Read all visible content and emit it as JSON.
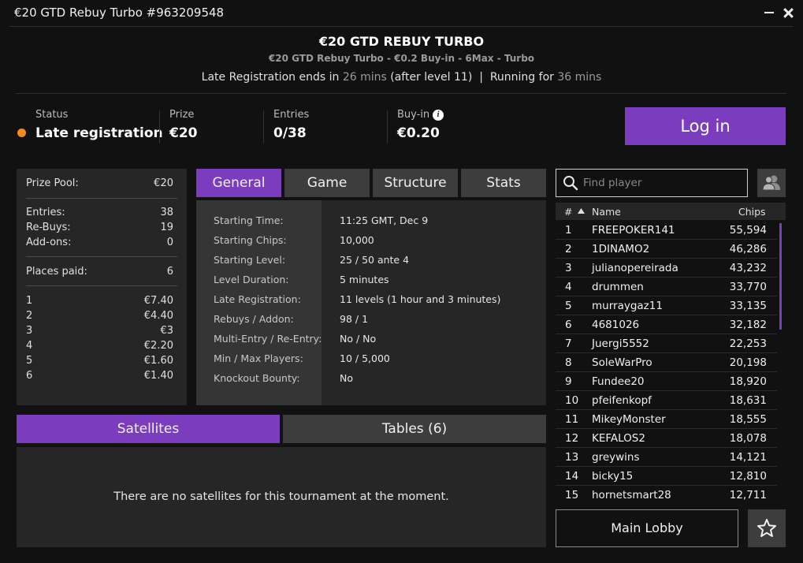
{
  "window": {
    "title": "€20 GTD Rebuy Turbo #963209548"
  },
  "header": {
    "name": "€20 GTD REBUY TURBO",
    "subtitle": "€20 GTD Rebuy Turbo - €0.2 Buy-in - 6Max - Turbo",
    "late_reg_prefix": "Late Registration ends in",
    "late_reg_time": "26 mins",
    "late_reg_suffix": "(after level 11)",
    "separator": "|",
    "running_prefix": "Running for",
    "running_time": "36 mins"
  },
  "stats": {
    "status_label": "Status",
    "status_value": "Late registration",
    "prize_label": "Prize",
    "prize_value": "€20",
    "entries_label": "Entries",
    "entries_value": "0/38",
    "buyin_label": "Buy-in",
    "buyin_value": "€0.20",
    "status_color": "#f18a21"
  },
  "login_button": "Log in",
  "prize_panel": {
    "pool_label": "Prize Pool:",
    "pool_value": "€20",
    "entries_label": "Entries:",
    "entries_value": "38",
    "rebuys_label": "Re-Buys:",
    "rebuys_value": "19",
    "addons_label": "Add-ons:",
    "addons_value": "0",
    "places_label": "Places paid:",
    "places_value": "6",
    "payouts": [
      {
        "place": "1",
        "amount": "€7.40"
      },
      {
        "place": "2",
        "amount": "€4.40"
      },
      {
        "place": "3",
        "amount": "€3"
      },
      {
        "place": "4",
        "amount": "€2.20"
      },
      {
        "place": "5",
        "amount": "€1.60"
      },
      {
        "place": "6",
        "amount": "€1.40"
      }
    ]
  },
  "tabs": [
    "General",
    "Game",
    "Structure",
    "Stats"
  ],
  "general": [
    {
      "label": "Starting Time:",
      "value": "11:25 GMT, Dec 9"
    },
    {
      "label": "Starting Chips:",
      "value": "10,000"
    },
    {
      "label": "Starting Level:",
      "value": "25 / 50 ante 4"
    },
    {
      "label": "Level Duration:",
      "value": "5 minutes"
    },
    {
      "label": "Late Registration:",
      "value": "11 levels (1 hour and 3 minutes)"
    },
    {
      "label": "Rebuys / Addon:",
      "value": "98 / 1"
    },
    {
      "label": "Multi-Entry / Re-Entry:",
      "value": "No / No"
    },
    {
      "label": "Min / Max Players:",
      "value": "10 / 5,000"
    },
    {
      "label": "Knockout Bounty:",
      "value": "No"
    }
  ],
  "bottom_tabs": {
    "satellites": "Satellites",
    "tables": "Tables (6)"
  },
  "satellites_message": "There are no satellites for this tournament at the moment.",
  "players": {
    "search_placeholder": "Find player",
    "col_rank": "#",
    "col_name": "Name",
    "col_chips": "Chips",
    "rows": [
      {
        "rank": "1",
        "name": "FREEPOKER141",
        "chips": "55,594"
      },
      {
        "rank": "2",
        "name": "1DINAMO2",
        "chips": "46,286"
      },
      {
        "rank": "3",
        "name": "julianopereirada",
        "chips": "43,232"
      },
      {
        "rank": "4",
        "name": "drummen",
        "chips": "33,770"
      },
      {
        "rank": "5",
        "name": "murraygaz11",
        "chips": "33,135"
      },
      {
        "rank": "6",
        "name": "4681026",
        "chips": "32,182"
      },
      {
        "rank": "7",
        "name": "Juergi5552",
        "chips": "22,253"
      },
      {
        "rank": "8",
        "name": "SoleWarPro",
        "chips": "20,198"
      },
      {
        "rank": "9",
        "name": "Fundee20",
        "chips": "18,920"
      },
      {
        "rank": "10",
        "name": "pfeifenkopf",
        "chips": "18,631"
      },
      {
        "rank": "11",
        "name": "MikeyMonster",
        "chips": "18,555"
      },
      {
        "rank": "12",
        "name": "KEFALOS2",
        "chips": "18,078"
      },
      {
        "rank": "13",
        "name": "greywins",
        "chips": "14,121"
      },
      {
        "rank": "14",
        "name": "bicky15",
        "chips": "12,810"
      },
      {
        "rank": "15",
        "name": "hornetsmart28",
        "chips": "12,711"
      }
    ]
  },
  "main_lobby_button": "Main Lobby",
  "colors": {
    "accent": "#7b3dbd",
    "background": "#111111",
    "panel": "#262626"
  },
  "icons": {
    "minimize": "minimize-icon",
    "close": "close-icon",
    "info": "info-icon",
    "search": "search-icon",
    "friends": "friends-icon",
    "sort": "sort-up-icon",
    "favorite": "star-icon"
  }
}
